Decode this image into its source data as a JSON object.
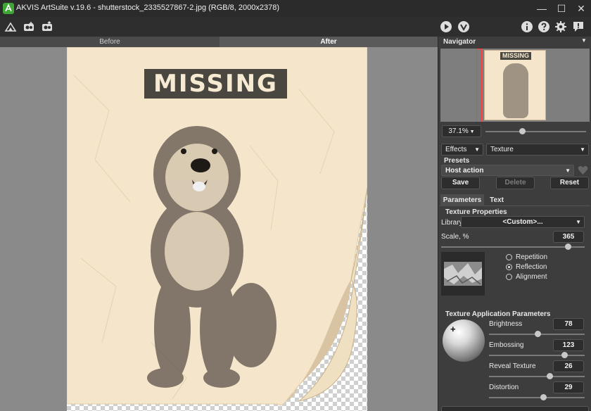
{
  "window": {
    "title": "AKVIS ArtSuite v.19.6 - shutterstock_2335527867-2.jpg (RGB/8, 2000x2378)",
    "minimize": "—",
    "maximize": "☐",
    "close": "✕"
  },
  "toolbar": {
    "left_icons": [
      "home-icon",
      "open-image-icon",
      "save-image-icon"
    ],
    "right_icons": [
      "run-icon",
      "apply-icon",
      "info-icon",
      "help-icon",
      "settings-icon",
      "notifications-icon"
    ]
  },
  "canvas": {
    "tab_before": "Before",
    "tab_after": "After",
    "image_text": "MISSING"
  },
  "navigator": {
    "title": "Navigator",
    "thumbnail_text": "MISSING",
    "zoom": "37.1%",
    "zoom_level": 0.37
  },
  "effects": {
    "category": "Effects",
    "effect": "Texture"
  },
  "presets": {
    "label": "Presets",
    "current": "Host action",
    "save": "Save",
    "delete": "Delete",
    "reset": "Reset"
  },
  "tabs": {
    "parameters": "Parameters",
    "text": "Text"
  },
  "texture_properties": {
    "title": "Texture Properties",
    "library_label": "Library",
    "library_value": "<Custom>...",
    "scale_label": "Scale, %",
    "scale_value": "365",
    "options": [
      "Repetition",
      "Reflection",
      "Alignment"
    ],
    "selected_option": "Reflection"
  },
  "application": {
    "title": "Texture Application Parameters",
    "brightness_label": "Brightness",
    "brightness_value": "78",
    "embossing_label": "Embossing",
    "embossing_value": "123",
    "reveal_label": "Reveal Texture",
    "reveal_value": "26",
    "distortion_label": "Distortion",
    "distortion_value": "29"
  },
  "colors": {
    "paper": "#f5e6cb",
    "panel": "#3d3d3d",
    "titlebar": "#2b2b2b",
    "accent_green": "#3fa535"
  }
}
